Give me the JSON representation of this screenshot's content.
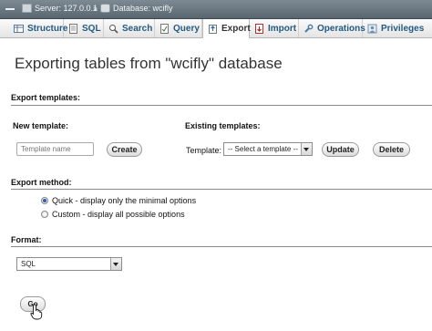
{
  "breadcrumb": {
    "server_label": "Server: 127.0.0.1",
    "separator": "»",
    "database_label": "Database: wcifly"
  },
  "tabs": [
    {
      "label": "Structure",
      "icon": "structure-icon"
    },
    {
      "label": "SQL",
      "icon": "sql-icon"
    },
    {
      "label": "Search",
      "icon": "search-icon"
    },
    {
      "label": "Query",
      "icon": "query-icon"
    },
    {
      "label": "Export",
      "icon": "export-icon",
      "active": true
    },
    {
      "label": "Import",
      "icon": "import-icon"
    },
    {
      "label": "Operations",
      "icon": "wrench-icon"
    },
    {
      "label": "Privileges",
      "icon": "privileges-icon"
    }
  ],
  "page_title": "Exporting tables from \"wcifly\" database",
  "export_templates": {
    "heading": "Export templates:",
    "new_template_label": "New template:",
    "template_name_placeholder": "Template name",
    "create_label": "Create",
    "existing_templates_label": "Existing templates:",
    "template_label": "Template:",
    "template_select_value": "-- Select a template --",
    "update_label": "Update",
    "delete_label": "Delete"
  },
  "export_method": {
    "heading": "Export method:",
    "options": [
      {
        "label": "Quick - display only the minimal options",
        "selected": true
      },
      {
        "label": "Custom - display all possible options",
        "selected": false
      }
    ]
  },
  "format": {
    "heading": "Format:",
    "value": "SQL"
  },
  "go_label": "Go",
  "colors": {
    "tab_text": "#235a81",
    "breadcrumb_bg": "#6b7882",
    "radio_selected": "#2c5fb0"
  }
}
